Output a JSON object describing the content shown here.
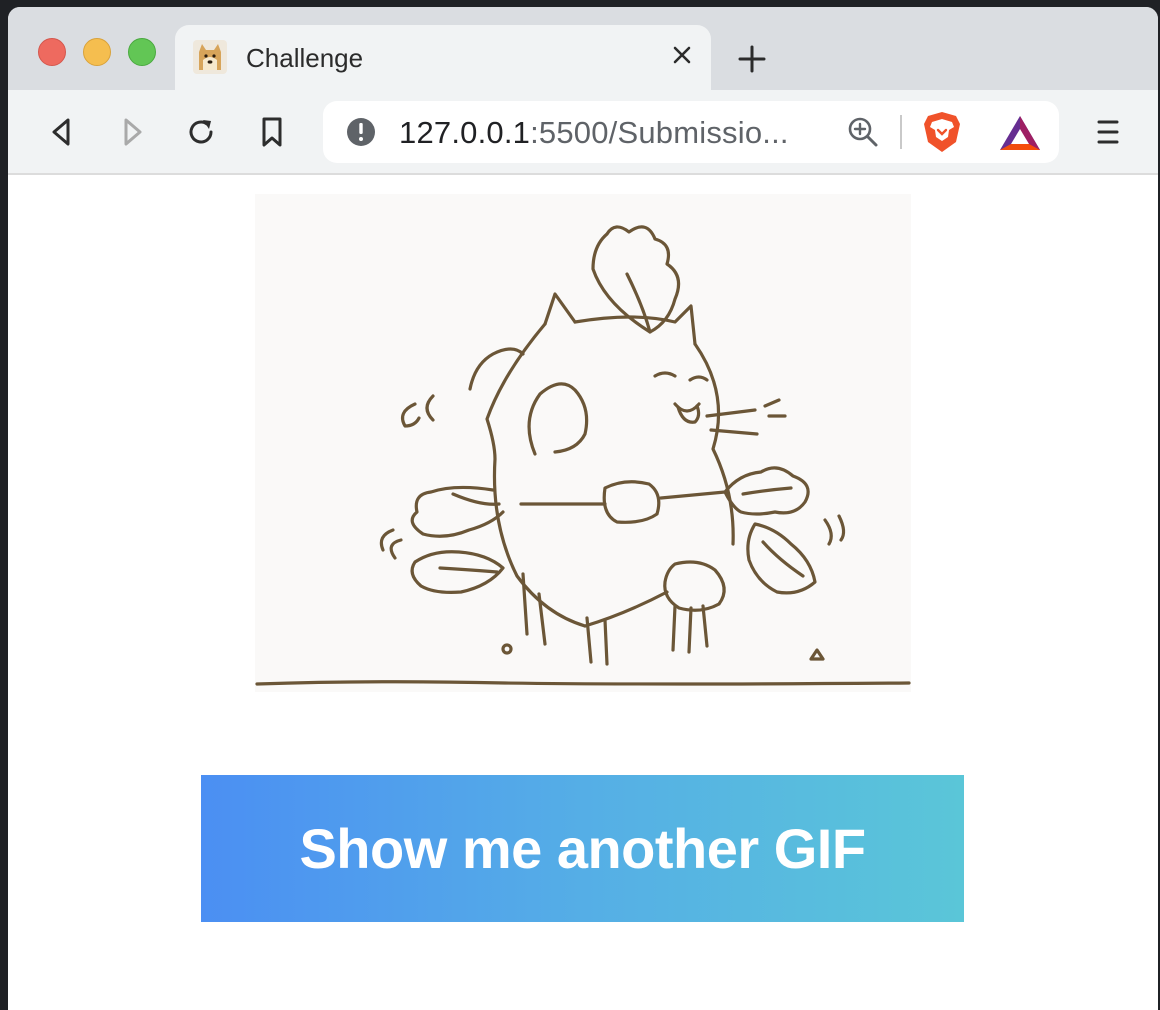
{
  "browser": {
    "tab": {
      "title": "Challenge",
      "favicon": "doge-favicon-icon",
      "close_icon": "close-icon"
    },
    "new_tab_icon": "plus-icon",
    "toolbar": {
      "back_icon": "back-arrow-icon",
      "forward_icon": "forward-arrow-icon",
      "reload_icon": "reload-icon",
      "bookmark_icon": "bookmark-icon",
      "address_bar": {
        "security_icon": "info-icon",
        "url_host": "127.0.0.1",
        "url_rest": ":5500/Submissio..."
      },
      "zoom_icon": "zoom-in-icon",
      "extensions": [
        "brave-shields-icon",
        "bat-rewards-icon"
      ],
      "menu_icon": "hamburger-menu-icon"
    }
  },
  "page": {
    "gif": {
      "description_icon": "cartoon-cat-gif-image"
    },
    "button": {
      "label": "Show me another GIF"
    }
  },
  "colors": {
    "button_gradient_start": "#4b8ff3",
    "button_gradient_end": "#5ac6d8",
    "button_text": "#ffffff",
    "brave_orange": "#f0522a",
    "sketch_line": "#6b5637"
  }
}
